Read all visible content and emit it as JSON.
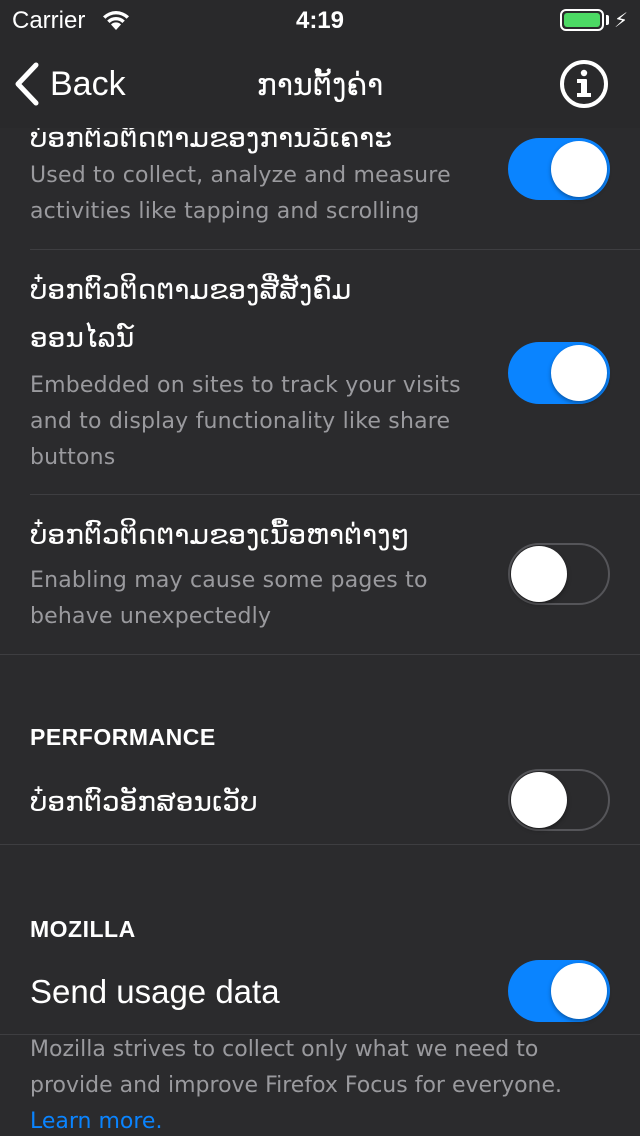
{
  "status_bar": {
    "carrier": "Carrier",
    "time": "4:19",
    "battery_level": 1.0,
    "battery_color": "#4cd964"
  },
  "nav": {
    "back_label": "Back",
    "title": "ການຕັ້ງຄ່າ"
  },
  "privacy": {
    "items": [
      {
        "title": "ບ໋ອກຕົວຕິດຕາມຂອງການວິເຄາະ",
        "subtitle": [
          "Used to collect, analyze and measure",
          "activities like tapping and scrolling"
        ],
        "enabled": true
      },
      {
        "title": [
          "ບ໋ອກຕົວຕິດຕາມຂອງສື່ສັງຄົມ",
          "ອອນໄລນ໌"
        ],
        "subtitle": [
          "Embedded on sites to track your visits",
          "and to display functionality like share",
          "buttons"
        ],
        "enabled": true
      },
      {
        "title": "ບ໋ອກຕົວຕິດຕາມຂອງເນື້ອຫາຕ່າງໆ",
        "subtitle": [
          "Enabling may cause some pages to",
          "behave unexpectedly"
        ],
        "enabled": false
      }
    ]
  },
  "performance": {
    "header": "PERFORMANCE",
    "items": [
      {
        "title": "ບ໋ອກຕົວອັກສອນເວັບ",
        "enabled": false
      }
    ]
  },
  "mozilla": {
    "header": "MOZILLA",
    "send_usage": {
      "title": "Send usage data",
      "enabled": true
    },
    "footer_lines": [
      "Mozilla strives to collect only what we need to",
      "provide and improve Firefox Focus for everyone."
    ],
    "learn_more": "Learn more."
  },
  "colors": {
    "accent": "#0a84ff",
    "background": "#2b2b2d",
    "secondary_text": "#9a9a9e"
  }
}
